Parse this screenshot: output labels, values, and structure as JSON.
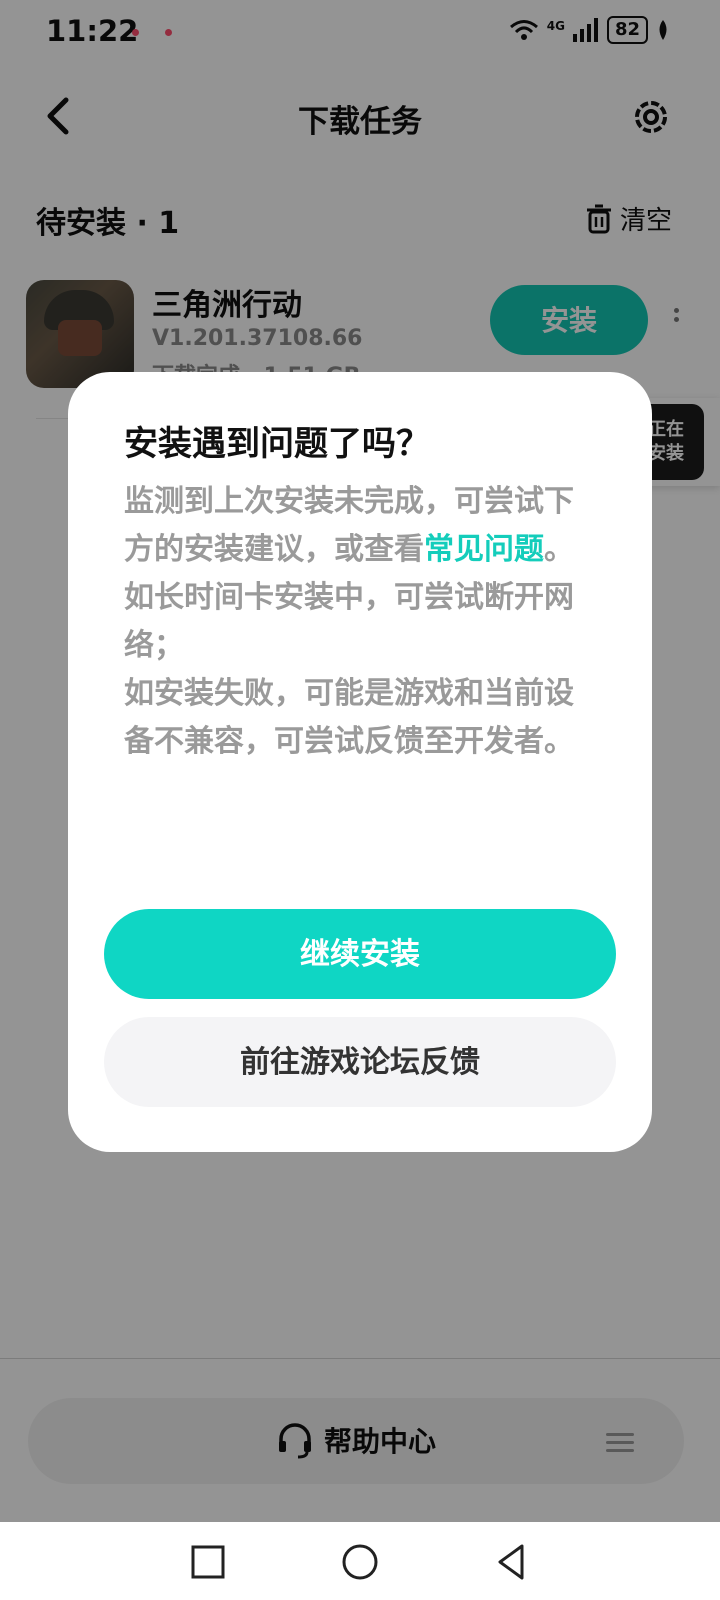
{
  "status_bar": {
    "time": "11:22",
    "network": "4G",
    "battery": "82"
  },
  "header": {
    "title": "下载任务"
  },
  "section": {
    "label": "待安装 · 1",
    "clear_label": "清空"
  },
  "app": {
    "name": "三角洲行动",
    "version": "V1.201.37108.66",
    "status": "下载完成 · 1.51 GB",
    "install_label": "安装"
  },
  "float_widget": {
    "label_line1": "正在",
    "label_line2": "安装"
  },
  "help": {
    "label": "帮助中心"
  },
  "dialog": {
    "title": "安装遇到问题了吗？",
    "body_part1": "监测到上次安装未完成，可尝试下方的安装建议，或查看",
    "faq_link": "常见问题",
    "body_part2": "。",
    "line2": "如长时间卡安装中，可尝试断开网络；",
    "line3": "如安装失败，可能是游戏和当前设备不兼容，可尝试反馈至开发者。",
    "primary_label": "继续安装",
    "secondary_label": "前往游戏论坛反馈"
  },
  "colors": {
    "accent": "#0fd6c4",
    "link": "#14cdbb",
    "install_button": "#14c7b4"
  }
}
